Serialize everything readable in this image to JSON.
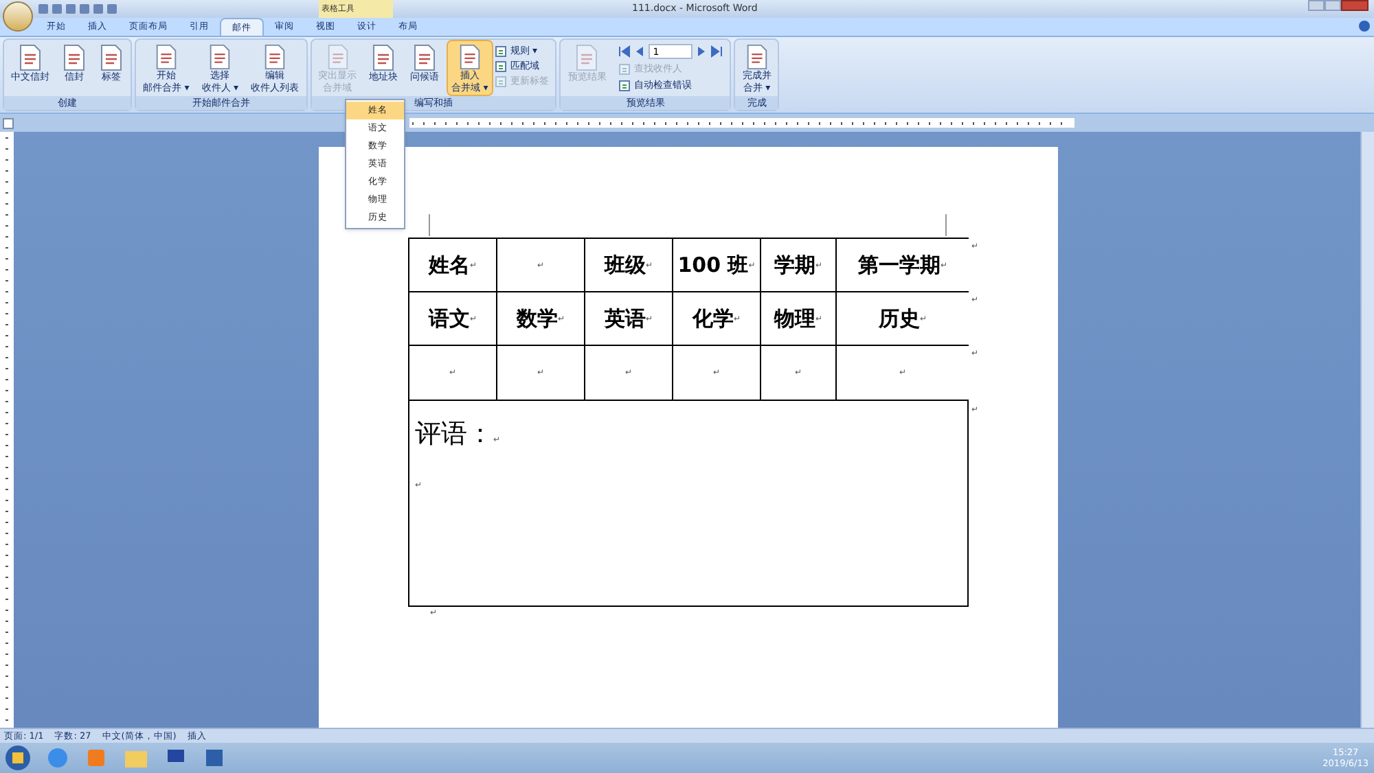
{
  "window": {
    "title": "111.docx - Microsoft Word",
    "context_tab_header": "表格工具"
  },
  "tabs": [
    {
      "label": "开始",
      "selected": false
    },
    {
      "label": "插入",
      "selected": false
    },
    {
      "label": "页面布局",
      "selected": false
    },
    {
      "label": "引用",
      "selected": false
    },
    {
      "label": "邮件",
      "selected": true
    },
    {
      "label": "审阅",
      "selected": false
    },
    {
      "label": "视图",
      "selected": false
    },
    {
      "label": "设计",
      "selected": false
    },
    {
      "label": "布局",
      "selected": false
    }
  ],
  "ribbon_groups": [
    {
      "label": "创建",
      "items": [
        {
          "kind": "large",
          "lines": [
            "中文信封"
          ],
          "disabled": false,
          "selected": false
        },
        {
          "kind": "large",
          "lines": [
            "信封"
          ],
          "disabled": false,
          "selected": false
        },
        {
          "kind": "large",
          "lines": [
            "标签"
          ],
          "disabled": false,
          "selected": false
        }
      ]
    },
    {
      "label": "开始邮件合并",
      "items": [
        {
          "kind": "large",
          "lines": [
            "开始",
            "邮件合并 ▾"
          ],
          "disabled": false,
          "selected": false
        },
        {
          "kind": "large",
          "lines": [
            "选择",
            "收件人 ▾"
          ],
          "disabled": false,
          "selected": false
        },
        {
          "kind": "large",
          "lines": [
            "编辑",
            "收件人列表"
          ],
          "disabled": false,
          "selected": false
        }
      ]
    },
    {
      "label": "编写和插",
      "items": [
        {
          "kind": "large",
          "lines": [
            "突出显示",
            "合并域"
          ],
          "disabled": true,
          "selected": false
        },
        {
          "kind": "large",
          "lines": [
            "地址块"
          ],
          "disabled": false,
          "selected": false
        },
        {
          "kind": "large",
          "lines": [
            "问候语"
          ],
          "disabled": false,
          "selected": false
        },
        {
          "kind": "large",
          "lines": [
            "插入",
            "合并域 ▾"
          ],
          "disabled": false,
          "selected": true
        },
        {
          "kind": "small",
          "lines": [
            "规则 ▾",
            "匹配域",
            "更新标签"
          ],
          "disabled_rows": [
            false,
            false,
            true
          ]
        }
      ]
    },
    {
      "label": "预览结果",
      "items": [
        {
          "kind": "large",
          "lines": [
            "预览结果"
          ],
          "disabled": true,
          "selected": false
        },
        {
          "kind": "nav",
          "record": "1",
          "lines": [
            "查找收件人",
            "自动检查错误"
          ],
          "disabled_rows": [
            true,
            false
          ]
        }
      ]
    },
    {
      "label": "完成",
      "items": [
        {
          "kind": "large",
          "lines": [
            "完成并",
            "合并 ▾"
          ],
          "disabled": false,
          "selected": false
        }
      ]
    }
  ],
  "merge_field_menu": [
    {
      "label": "姓名",
      "selected": true
    },
    {
      "label": "语文",
      "selected": false
    },
    {
      "label": "数学",
      "selected": false
    },
    {
      "label": "英语",
      "selected": false
    },
    {
      "label": "化学",
      "selected": false
    },
    {
      "label": "物理",
      "selected": false
    },
    {
      "label": "历史",
      "selected": false
    }
  ],
  "table": {
    "rows": [
      {
        "cells": [
          "姓名",
          "",
          "班级",
          "100 班",
          "学期",
          "第一学期"
        ]
      },
      {
        "cells": [
          "语文",
          "数学",
          "英语",
          "化学",
          "物理",
          "历史"
        ]
      },
      {
        "cells": [
          "",
          "",
          "",
          "",
          "",
          ""
        ]
      }
    ],
    "comment": "评语：",
    "mark": "↵"
  },
  "status_bar": [
    "页面: 1/1",
    "字数: 27",
    "中文(简体，中国)",
    "插入"
  ],
  "taskbar": {
    "time": "15:27",
    "date": "2019/6/13"
  }
}
